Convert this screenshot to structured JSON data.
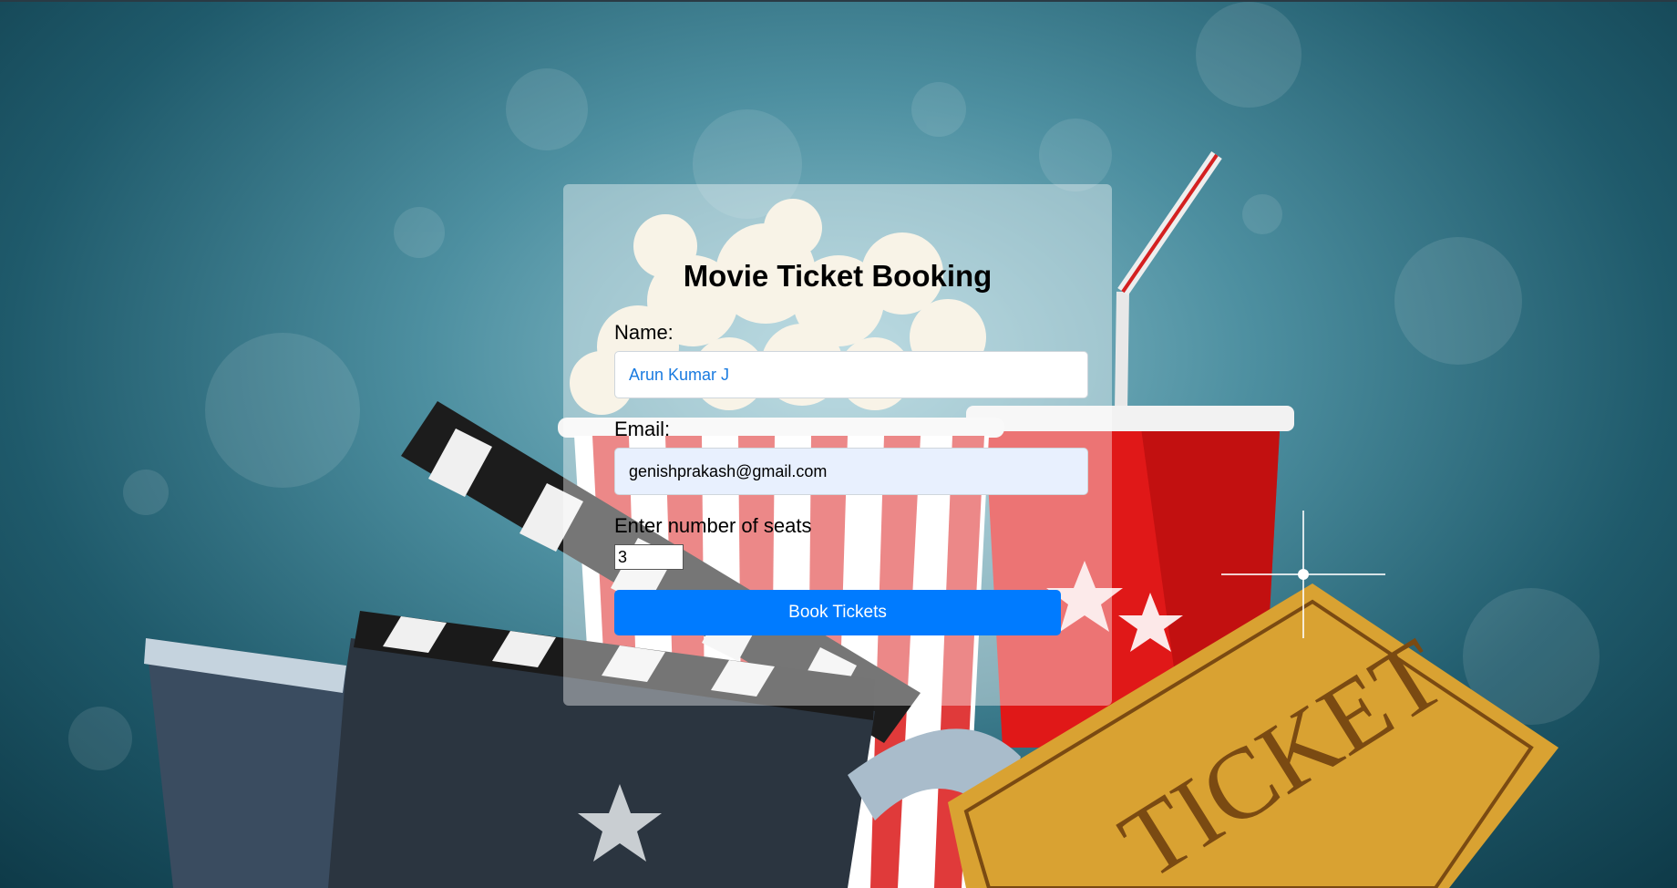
{
  "form": {
    "title": "Movie Ticket Booking",
    "name_label": "Name:",
    "name_value": "Arun Kumar J",
    "email_label": "Email:",
    "email_value": "genishprakash@gmail.com",
    "seats_label": "Enter number of seats",
    "seats_value": "3",
    "submit_label": "Book Tickets"
  },
  "background": {
    "ticket_text": "TICKET"
  },
  "colors": {
    "button": "#007bff",
    "name_text": "#1a7be0",
    "email_autofill_bg": "#e8f0fe"
  }
}
